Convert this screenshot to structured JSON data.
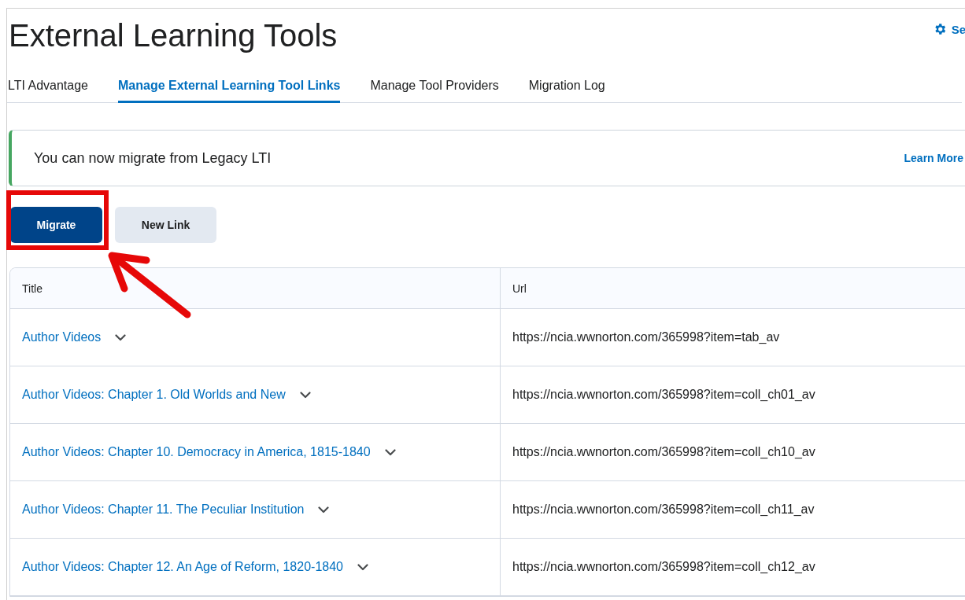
{
  "page": {
    "title": "External Learning Tools",
    "settings_link": {
      "label": "Se"
    }
  },
  "tabs": [
    {
      "label": "LTI Advantage",
      "selected": false
    },
    {
      "label": "Manage External Learning Tool Links",
      "selected": true
    },
    {
      "label": "Manage Tool Providers",
      "selected": false
    },
    {
      "label": "Migration Log",
      "selected": false
    }
  ],
  "alert": {
    "message": "You can now migrate from Legacy LTI",
    "link": "Learn More"
  },
  "buttons": [
    {
      "label": "Migrate",
      "kind": "primary",
      "highlighted": true
    },
    {
      "label": "New Link",
      "kind": "secondary",
      "highlighted": false
    }
  ],
  "table": {
    "columns": [
      "Title",
      "Url"
    ],
    "rows": [
      {
        "title": "Author Videos",
        "url": "https://ncia.wwnorton.com/365998?item=tab_av"
      },
      {
        "title": "Author Videos: Chapter 1. Old Worlds and New",
        "url": "https://ncia.wwnorton.com/365998?item=coll_ch01_av"
      },
      {
        "title": "Author Videos: Chapter 10. Democracy in America, 1815-1840",
        "url": "https://ncia.wwnorton.com/365998?item=coll_ch10_av"
      },
      {
        "title": "Author Videos: Chapter 11. The Peculiar Institution",
        "url": "https://ncia.wwnorton.com/365998?item=coll_ch11_av"
      },
      {
        "title": "Author Videos: Chapter 12. An Age of Reform, 1820-1840",
        "url": "https://ncia.wwnorton.com/365998?item=coll_ch12_av"
      }
    ]
  }
}
